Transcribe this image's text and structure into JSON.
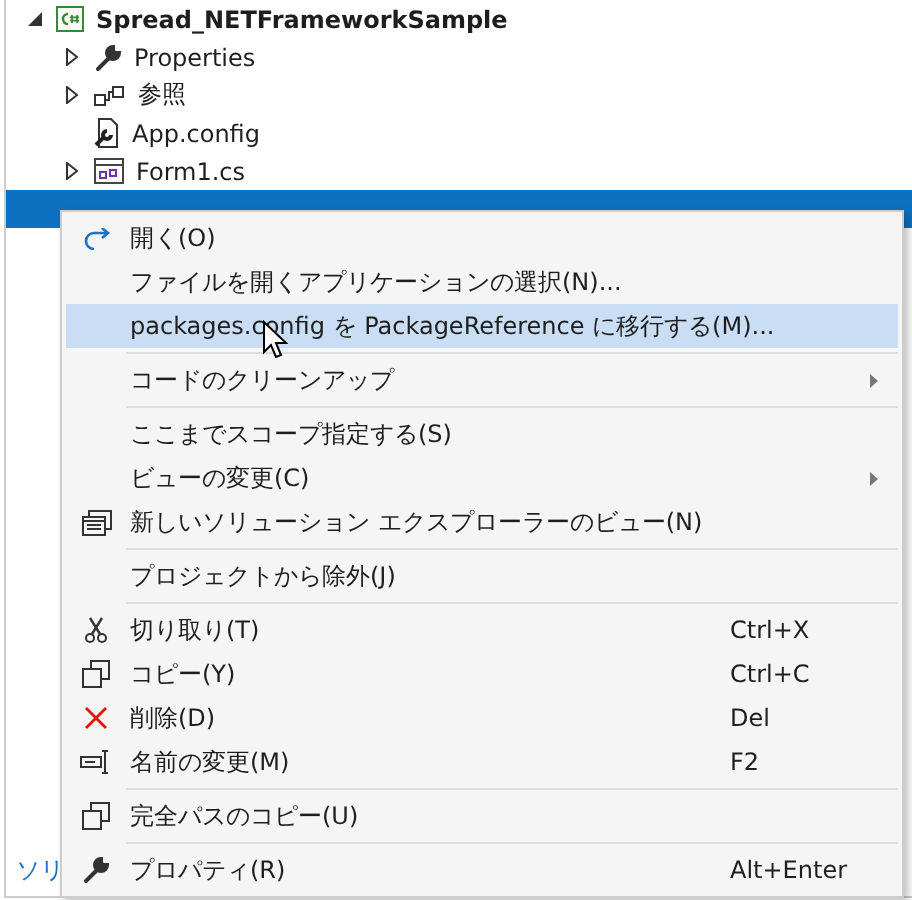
{
  "tree": {
    "root": {
      "label": "Spread_NETFrameworkSample",
      "kind": "expandable",
      "expanded": true,
      "children": [
        {
          "label": "Properties",
          "kind": "expandable"
        },
        {
          "label": "参照",
          "kind": "expandable"
        },
        {
          "label": "App.config",
          "kind": "leaf"
        },
        {
          "label": "Form1.cs",
          "kind": "expandable"
        },
        {
          "kind": "covered",
          "selected": true
        }
      ]
    }
  },
  "footer_link": "ソリ",
  "context_menu": [
    {
      "kind": "item",
      "label": "開く(O)",
      "selected": false
    },
    {
      "kind": "item",
      "label": "ファイルを開くアプリケーションの選択(N)...",
      "selected": false
    },
    {
      "kind": "item",
      "label": "packages.config を PackageReference に移行する(M)...",
      "selected": true
    },
    {
      "kind": "separator"
    },
    {
      "kind": "item",
      "label": "コードのクリーンアップ",
      "submenu": true,
      "selected": false
    },
    {
      "kind": "separator"
    },
    {
      "kind": "item",
      "label": "ここまでスコープ指定する(S)",
      "selected": false
    },
    {
      "kind": "item",
      "label": "ビューの変更(C)",
      "submenu": true,
      "selected": false
    },
    {
      "kind": "item",
      "label": "新しいソリューション エクスプローラーのビュー(N)",
      "selected": false
    },
    {
      "kind": "separator"
    },
    {
      "kind": "item",
      "label": "プロジェクトから除外(J)",
      "selected": false
    },
    {
      "kind": "separator"
    },
    {
      "kind": "item",
      "label": "切り取り(T)",
      "shortcut": "Ctrl+X",
      "selected": false
    },
    {
      "kind": "item",
      "label": "コピー(Y)",
      "shortcut": "Ctrl+C",
      "selected": false
    },
    {
      "kind": "item",
      "label": "削除(D)",
      "shortcut": "Del",
      "selected": false
    },
    {
      "kind": "item",
      "label": "名前の変更(M)",
      "shortcut": "F2",
      "selected": false
    },
    {
      "kind": "separator"
    },
    {
      "kind": "item",
      "label": "完全パスのコピー(U)",
      "selected": false
    },
    {
      "kind": "separator"
    },
    {
      "kind": "item",
      "label": "プロパティ(R)",
      "shortcut": "Alt+Enter",
      "selected": false
    }
  ]
}
